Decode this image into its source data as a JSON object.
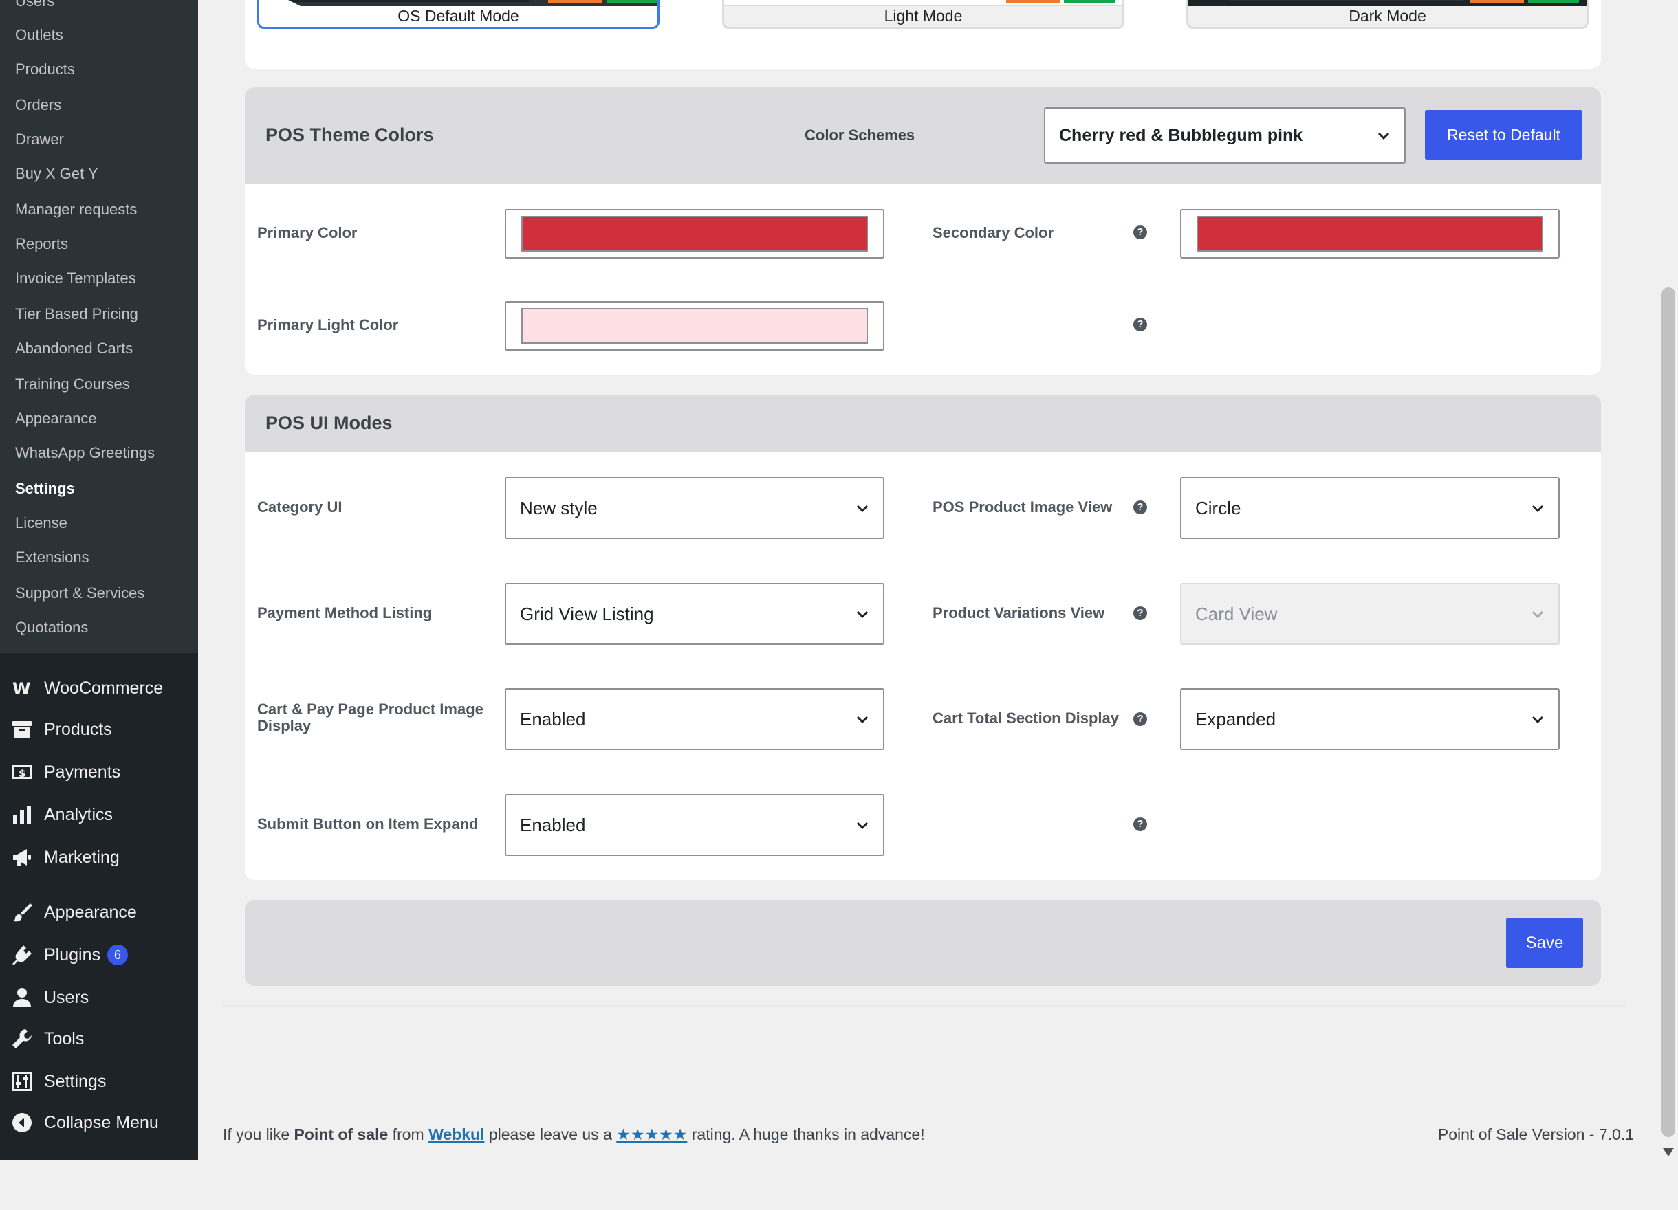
{
  "submenu": {
    "items": [
      "Users",
      "Outlets",
      "Products",
      "Orders",
      "Drawer",
      "Buy X Get Y",
      "Manager requests",
      "Reports",
      "Invoice Templates",
      "Tier Based Pricing",
      "Abandoned Carts",
      "Training Courses",
      "Appearance",
      "WhatsApp Greetings",
      "Settings",
      "License",
      "Extensions",
      "Support & Services",
      "Quotations"
    ],
    "current": "Settings"
  },
  "menu": {
    "woocommerce": "WooCommerce",
    "products": "Products",
    "payments": "Payments",
    "analytics": "Analytics",
    "marketing": "Marketing",
    "appearance": "Appearance",
    "plugins": "Plugins",
    "plugins_badge": "6",
    "users": "Users",
    "tools": "Tools",
    "settings": "Settings",
    "collapse": "Collapse Menu"
  },
  "modes": {
    "os_default": "OS Default Mode",
    "light": "Light Mode",
    "dark": "Dark Mode",
    "selected": "OS Default Mode"
  },
  "theme_colors": {
    "title": "POS Theme Colors",
    "scheme_label": "Color Schemes",
    "scheme_value": "Cherry red & Bubblegum pink",
    "reset_label": "Reset to Default",
    "primary_label": "Primary Color",
    "primary_value": "#d0303c",
    "secondary_label": "Secondary Color",
    "secondary_value": "#d0303c",
    "primary_light_label": "Primary Light Color",
    "primary_light_value": "#fde0e4"
  },
  "ui_modes": {
    "title": "POS UI Modes",
    "category_ui_label": "Category UI",
    "category_ui_value": "New style",
    "image_view_label": "POS Product Image View",
    "image_view_value": "Circle",
    "payment_listing_label": "Payment Method Listing",
    "payment_listing_value": "Grid View Listing",
    "variations_label": "Product Variations View",
    "variations_value": "Card View",
    "cart_image_label": "Cart & Pay Page Product Image Display",
    "cart_image_value": "Enabled",
    "cart_total_label": "Cart Total Section Display",
    "cart_total_value": "Expanded",
    "submit_expand_label": "Submit Button on Item Expand",
    "submit_expand_value": "Enabled"
  },
  "save_label": "Save",
  "footer": {
    "prefix": "If you like ",
    "plugin_name": "Point of sale",
    "from": " from ",
    "vendor": "Webkul",
    "middle": " please leave us a ",
    "stars": "★★★★★",
    "suffix": " rating. A huge thanks in advance!",
    "version": "Point of Sale Version - 7.0.1"
  }
}
